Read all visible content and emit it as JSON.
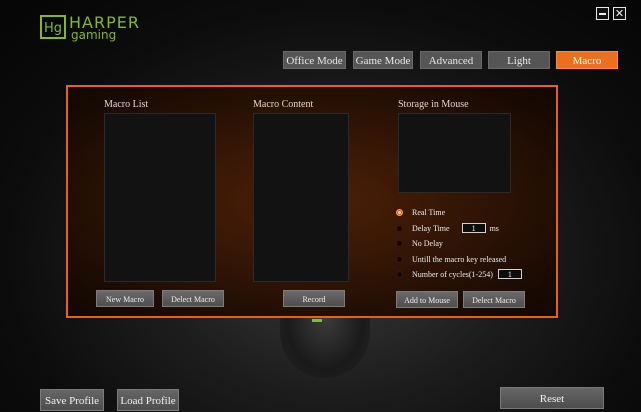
{
  "logo": {
    "mark": "Hg",
    "line1": "HARPER",
    "line2": "gaming"
  },
  "window": {
    "minimize_label": "",
    "close_label": "✕"
  },
  "tabs": [
    {
      "label": "Office Mode",
      "active": false
    },
    {
      "label": "Game Mode",
      "active": false
    },
    {
      "label": "Advanced",
      "active": false
    },
    {
      "label": "Light",
      "active": false
    },
    {
      "label": "Macro",
      "active": true
    }
  ],
  "sections": {
    "macro_list": "Macro List",
    "macro_content": "Macro Content",
    "storage": "Storage in Mouse"
  },
  "buttons": {
    "new_macro": "New Macro",
    "delete_macro_left": "Delect Macro",
    "record": "Record",
    "add_to_mouse": "Add to Mouse",
    "delete_macro_right": "Delect Macro"
  },
  "options": {
    "real_time": "Real Time",
    "delay_time": "Delay Time",
    "delay_value": "1",
    "delay_unit": "ms",
    "no_delay": "No Delay",
    "until_release": "Untill the macro key released",
    "num_cycles": "Number of cycles(1-254)",
    "cycles_value": "1",
    "selected": "real_time"
  },
  "footer": {
    "save_profile": "Save Profile",
    "load_profile": "Load Profile",
    "reset": "Reset"
  },
  "colors": {
    "accent": "#ea6f1f",
    "logo_green": "#86b728"
  }
}
